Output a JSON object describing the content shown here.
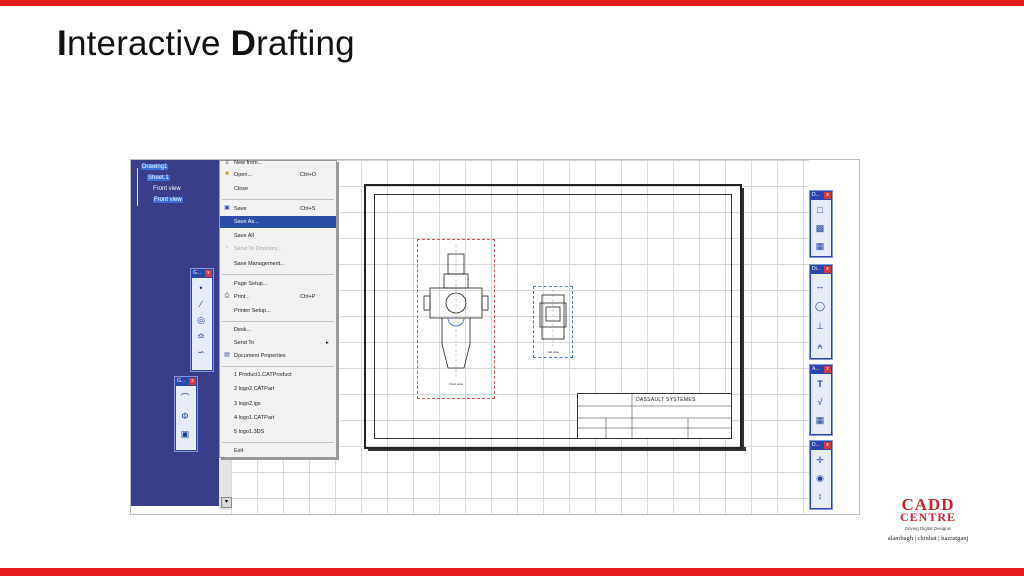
{
  "slide": {
    "title_initial_1": "I",
    "title_rest_1": "nteractive ",
    "title_initial_2": "D",
    "title_rest_2": "rafting"
  },
  "colors": {
    "accent_red": "#e31b1b",
    "tree_bg": "#3a3d8a",
    "menu_highlight": "#2a4ea6"
  },
  "tree": {
    "root": "Drawing1",
    "sheet": "Sheet.1",
    "views": [
      "Front view",
      "Front view"
    ]
  },
  "file_menu": {
    "items": [
      {
        "label": "New from...",
        "shortcut": "",
        "state": "normal"
      },
      {
        "label": "Open...",
        "shortcut": "Ctrl+O",
        "state": "normal"
      },
      {
        "label": "Close",
        "shortcut": "",
        "state": "normal"
      },
      {
        "label": "Save",
        "shortcut": "Ctrl+S",
        "state": "normal"
      },
      {
        "label": "Save As...",
        "shortcut": "",
        "state": "highlighted"
      },
      {
        "label": "Save All",
        "shortcut": "",
        "state": "normal"
      },
      {
        "label": "Send To Directory...",
        "shortcut": "",
        "state": "disabled"
      },
      {
        "label": "Save Management...",
        "shortcut": "",
        "state": "normal"
      },
      {
        "label": "Page Setup...",
        "shortcut": "",
        "state": "normal"
      },
      {
        "label": "Print...",
        "shortcut": "Ctrl+P",
        "state": "normal"
      },
      {
        "label": "Printer Setup...",
        "shortcut": "",
        "state": "normal"
      },
      {
        "label": "Desk...",
        "shortcut": "",
        "state": "normal"
      },
      {
        "label": "Send To",
        "shortcut": "",
        "state": "normal"
      },
      {
        "label": "Document Properties",
        "shortcut": "",
        "state": "normal"
      },
      {
        "label": "1 Product1.CATProduct",
        "shortcut": "",
        "state": "normal"
      },
      {
        "label": "2 logo2.CATPart",
        "shortcut": "",
        "state": "normal"
      },
      {
        "label": "3 logo2.igs",
        "shortcut": "",
        "state": "normal"
      },
      {
        "label": "4 logo1.CATPart",
        "shortcut": "",
        "state": "normal"
      },
      {
        "label": "5 logo1.3DS",
        "shortcut": "",
        "state": "normal"
      },
      {
        "label": "Exit",
        "shortcut": "",
        "state": "normal"
      }
    ]
  },
  "toolbars": {
    "left_1": "G...",
    "left_2": "G...",
    "right_1": "D...",
    "right_2": "Di...",
    "right_3": "A...",
    "right_4": "D..."
  },
  "drawing": {
    "title_block_company": "DASSAULT SYSTEMES"
  },
  "logo": {
    "name_line1": "CADD",
    "name_line2": "CENTRE",
    "tagline": "Driving Digital Designs!",
    "locations": "alambagh | chinhat | hazratganj"
  }
}
